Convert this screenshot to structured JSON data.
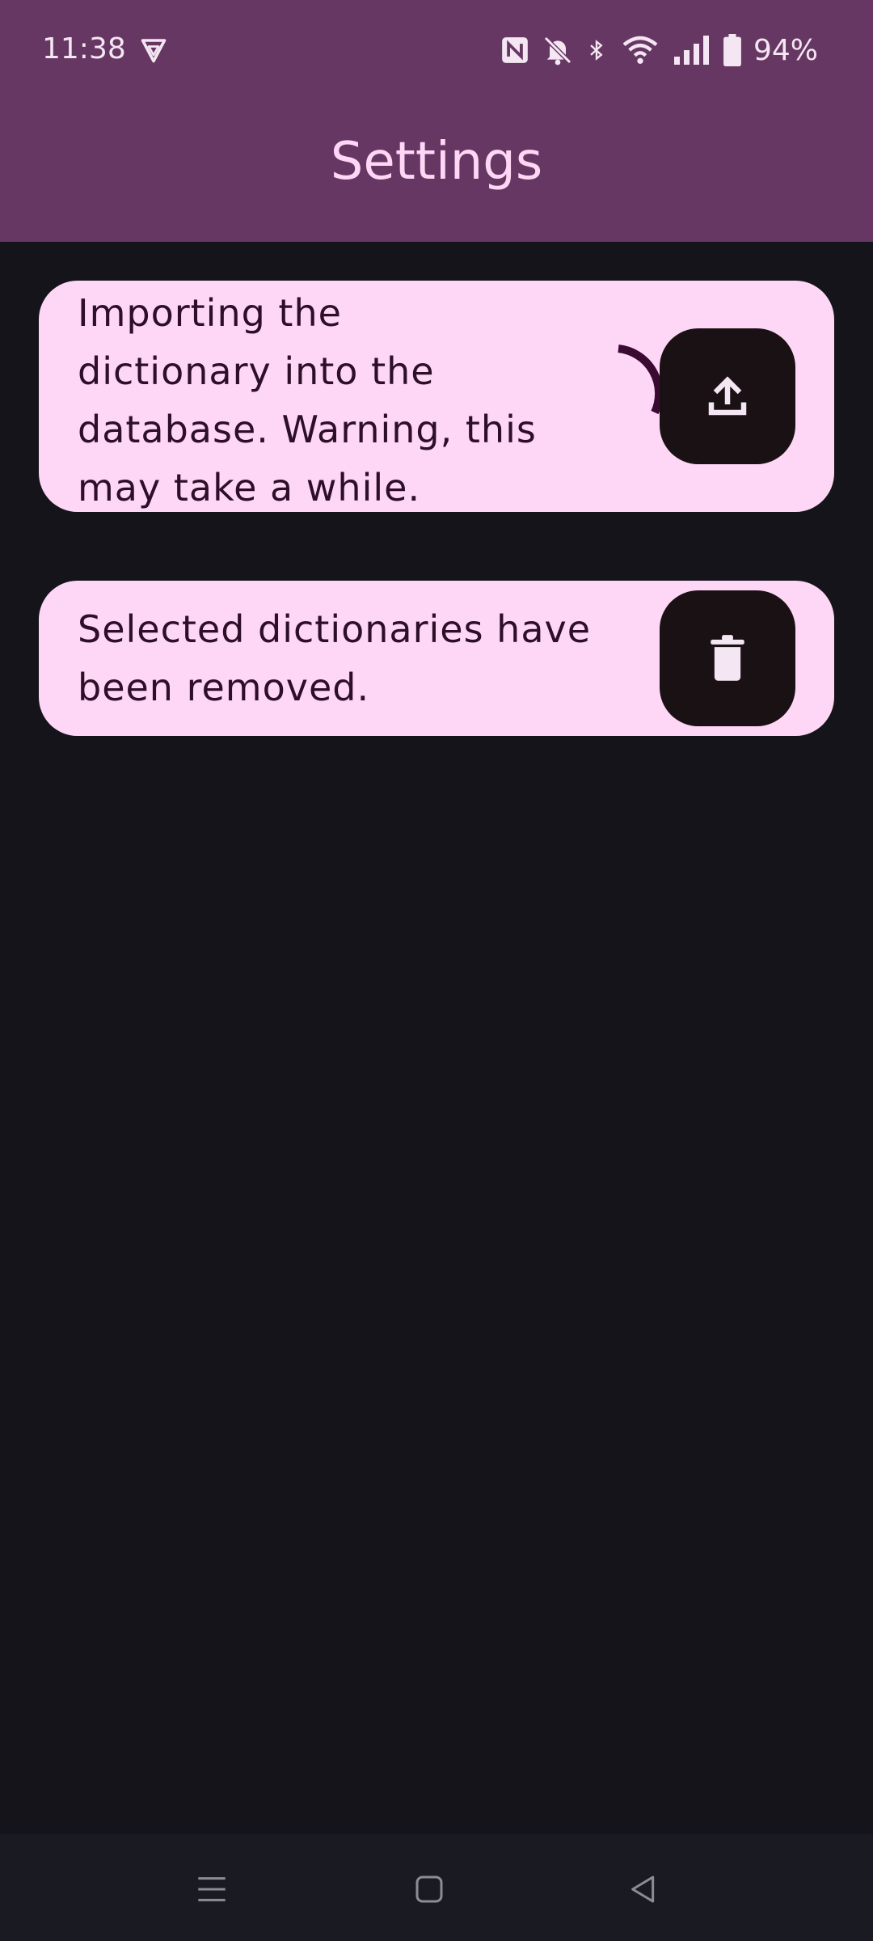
{
  "status_bar": {
    "time": "11:38",
    "battery": "94%",
    "icons": [
      "vpn-icon",
      "nfc-icon",
      "mute-icon",
      "bluetooth-icon",
      "wifi-icon",
      "signal-icon",
      "battery-icon"
    ]
  },
  "app_bar": {
    "title": "Settings"
  },
  "import_card": {
    "message": "Importing the dictionary into the database. Warning, this may take a while.",
    "action_icon": "upload-icon",
    "loading": true
  },
  "remove_card": {
    "message": "Selected dictionaries have been removed.",
    "action_icon": "trash-icon"
  },
  "nav_bar": {
    "buttons": [
      "menu-icon",
      "home-icon",
      "back-icon"
    ]
  },
  "colors": {
    "app_bar": "#673763",
    "card": "#ffd7f6",
    "card_text": "#2d0f2a",
    "fab": "#1a1114",
    "background": "#14141a"
  }
}
